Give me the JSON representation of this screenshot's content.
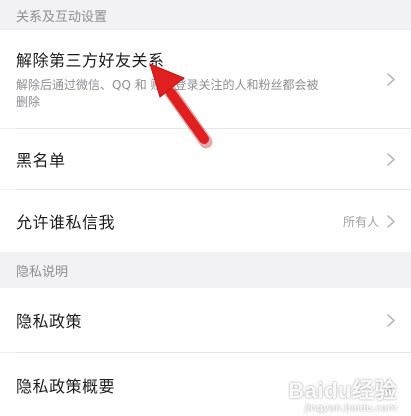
{
  "sections": {
    "interaction_header": "关系及互动设置",
    "privacy_header": "隐私说明"
  },
  "items": {
    "unlink": {
      "label": "解除第三方好友关系",
      "desc": "解除后通过微信、QQ 和 账号登录关注的人和粉丝都会被删除"
    },
    "blacklist": {
      "label": "黑名单"
    },
    "dm": {
      "label": "允许谁私信我",
      "value": "所有人"
    },
    "policy": {
      "label": "隐私政策"
    },
    "policy_summary": {
      "label": "隐私政策概要"
    }
  },
  "annotation": {
    "arrow_color": "#e02020"
  },
  "watermark": {
    "brand": "Baidu经验",
    "url": "jingyan.baidu.com"
  }
}
